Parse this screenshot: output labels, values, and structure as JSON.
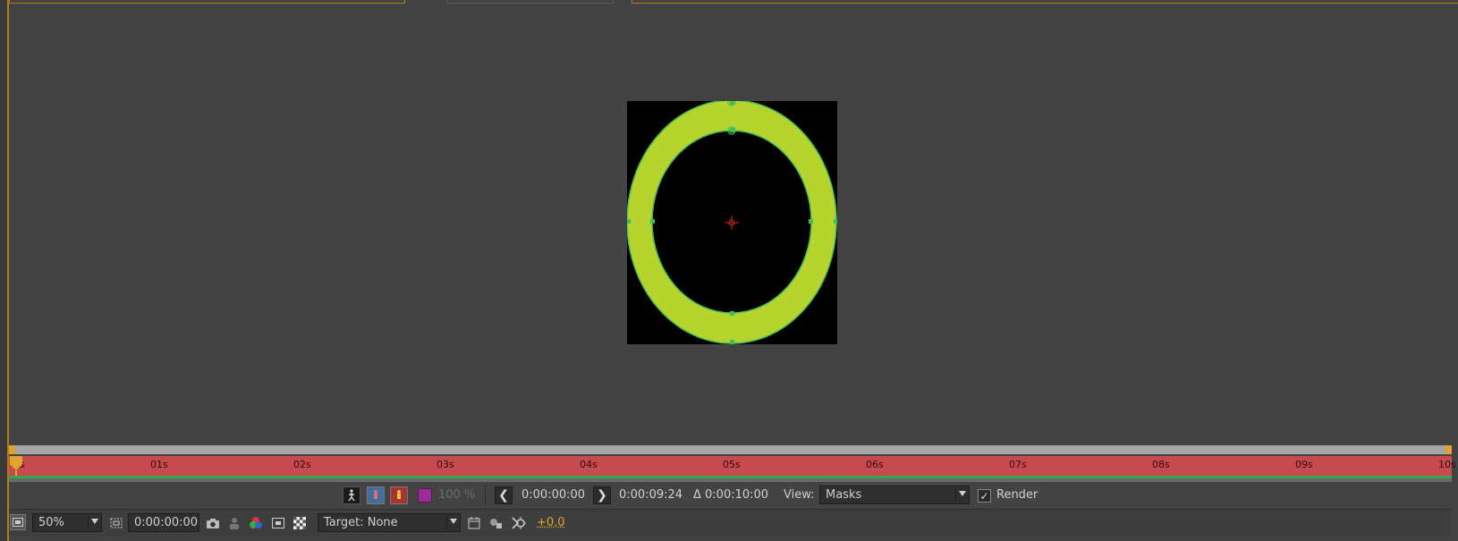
{
  "viewer": {
    "ruler_ticks": [
      "0s",
      "01s",
      "02s",
      "03s",
      "04s",
      "05s",
      "06s",
      "07s",
      "08s",
      "09s",
      "10s"
    ]
  },
  "preview_bar": {
    "exposure_percent": "100 %",
    "start_time": "0:00:00:00",
    "end_time": "0:00:09:24",
    "duration": "Δ 0:00:10:00",
    "view_label": "View:",
    "view_value": "Masks",
    "render_label": "Render",
    "render_checked": true
  },
  "viewer_controls": {
    "zoom": "50%",
    "timecode": "0:00:00:00",
    "target": "Target: None",
    "exposure_offset": "+0,0"
  },
  "colors": {
    "ring_fill": "#b7d42e",
    "mask_stroke": "#3fbf5a",
    "ruler_bar": "#c74a4f",
    "accent": "#e0a42a"
  }
}
